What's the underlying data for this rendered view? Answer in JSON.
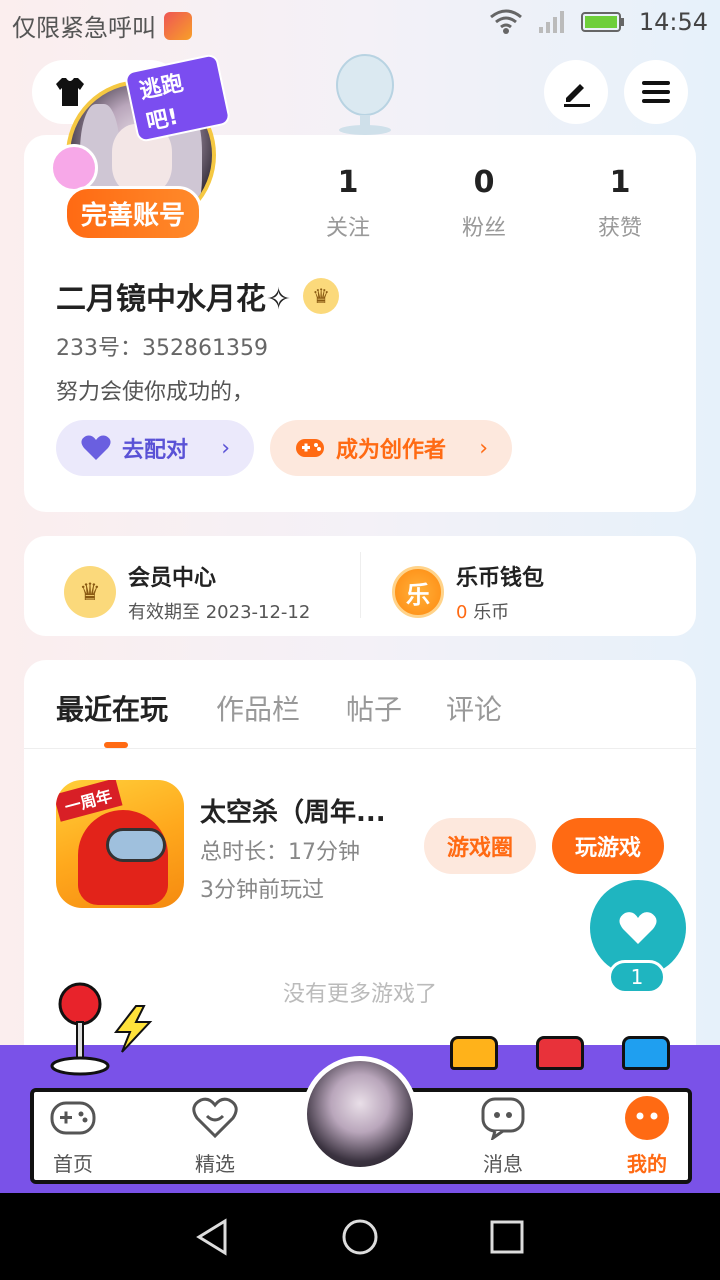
{
  "status_bar": {
    "carrier_text": "仅限紧急呼叫",
    "time": "14:54"
  },
  "profile": {
    "avatar_tag": "逃跑吧!",
    "complete_account_label": "完善账号",
    "stats": [
      {
        "value": "1",
        "label": "关注"
      },
      {
        "value": "0",
        "label": "粉丝"
      },
      {
        "value": "1",
        "label": "获赞"
      }
    ],
    "username": "二月镜中水月花✧",
    "uid": "233号：352861359",
    "bio": "努力会使你成功的，",
    "match_button": "去配对",
    "creator_button": "成为创作者"
  },
  "member": {
    "vip_title": "会员中心",
    "vip_sub": "有效期至 2023-12-12",
    "vip_icon": "crown-icon",
    "wallet_title": "乐币钱包",
    "wallet_amount": "0",
    "wallet_unit": "乐币",
    "wallet_icon_char": "乐"
  },
  "tabs": [
    "最近在玩",
    "作品栏",
    "帖子",
    "评论"
  ],
  "active_tab": 0,
  "recent_game": {
    "badge": "一周年",
    "title": "太空杀（周年...",
    "duration": "总时长：17分钟",
    "last_played": "3分钟前玩过",
    "circle_button": "游戏圈",
    "play_button": "玩游戏"
  },
  "no_more_text": "没有更多游戏了",
  "like": {
    "count": "1"
  },
  "bottom_nav": [
    {
      "label": "首页",
      "icon": "gamepad-icon"
    },
    {
      "label": "精选",
      "icon": "heart-outline-icon"
    },
    {
      "label": "消息",
      "icon": "chat-icon"
    },
    {
      "label": "我的",
      "icon": "profile-face-icon"
    }
  ],
  "colors": {
    "accent": "#ff6a13",
    "nav_purple": "#7a52e8",
    "like_teal": "#1fb5c0"
  }
}
